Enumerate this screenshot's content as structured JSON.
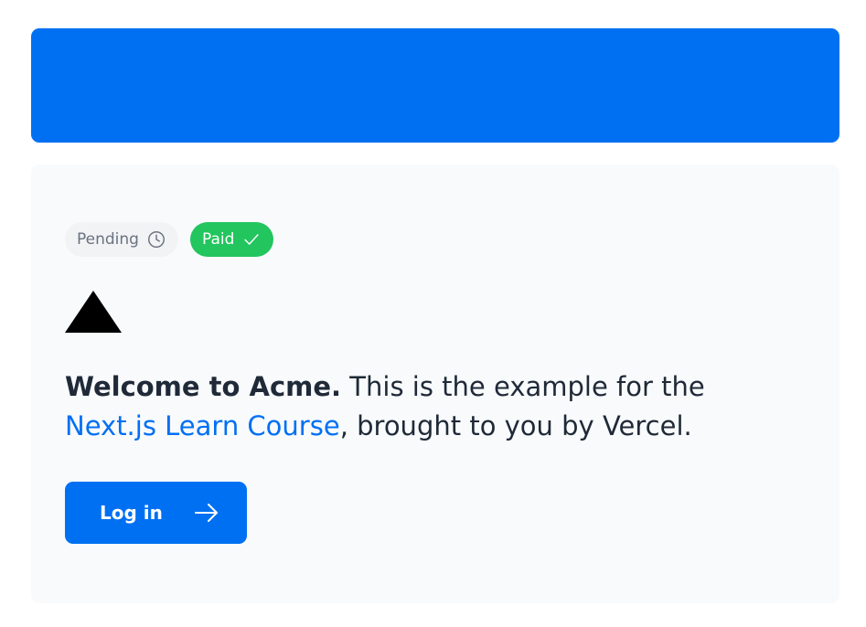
{
  "badges": {
    "pending": {
      "label": "Pending",
      "icon": "clock-icon"
    },
    "paid": {
      "label": "Paid",
      "icon": "check-icon"
    }
  },
  "logo": {
    "icon": "triangle-logo-icon"
  },
  "welcome": {
    "bold": "Welcome to Acme.",
    "text_before_link": " This is the example for the ",
    "link_text": "Next.js Learn Course",
    "text_after_link": ", brought to you by Vercel."
  },
  "login_button": {
    "label": "Log in",
    "icon": "arrow-right-icon"
  },
  "colors": {
    "accent": "#0070f3",
    "paid": "#22c55e",
    "card_bg": "#f8fafc"
  }
}
